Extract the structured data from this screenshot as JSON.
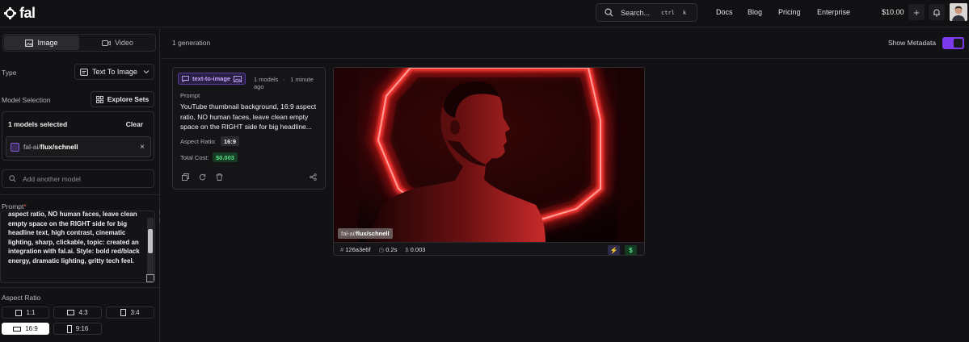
{
  "header": {
    "logo_text": "fal",
    "search_label": "Search...",
    "shortcut_ctrl": "ctrl",
    "shortcut_key": "k",
    "nav": [
      "Docs",
      "Blog",
      "Pricing",
      "Enterprise"
    ],
    "balance": "$10.00"
  },
  "sidebar": {
    "tabs": [
      "Image",
      "Video"
    ],
    "type_label": "Type",
    "type_value": "Text To Image",
    "model_selection_label": "Model Selection",
    "explore_sets_label": "Explore Sets",
    "models_selected": "1 models selected",
    "clear_label": "Clear",
    "model_prefix": "fal-ai/",
    "model_name": "flux/schnell",
    "add_model_placeholder": "Add another model",
    "prompt_label": "Prompt",
    "prompt_required": "*",
    "prompt_visible_text": "aspect ratio, NO human faces, leave clean empty space on the RIGHT side for big headline text, high contrast, cinematic lighting, sharp, clickable, topic: created an integration with fal.ai. Style: bold red/black energy, dramatic lighting, gritty tech feel.",
    "aspect_ratio_label": "Aspect Ratio",
    "aspect_ratios": [
      "1:1",
      "4:3",
      "3:4",
      "16:9",
      "9:16"
    ],
    "aspect_ratio_selected": "16:9"
  },
  "main": {
    "generation_count": "1 generation",
    "show_metadata_label": "Show Metadata",
    "show_metadata_on": true,
    "card": {
      "badge": "text-to-image",
      "models": "1 models",
      "separator": "·",
      "time_ago": "1 minute ago",
      "prompt_label": "Prompt",
      "prompt_text": "YouTube thumbnail background, 16:9 aspect ratio, NO human faces, leave clean empty space on the RIGHT side for big headline...",
      "aspect_ratio_label": "Aspect Ratio:",
      "aspect_ratio_value": "16:9",
      "total_cost_label": "Total Cost:",
      "total_cost_value": "$0.003"
    },
    "result": {
      "model_prefix": "fal-ai/",
      "model_name": "flux/schnell",
      "hash_symbol": "#",
      "id": "126a3e6f",
      "duration": "0.2s",
      "cost_symbol": "$",
      "cost": "0.003"
    }
  },
  "colors": {
    "accent": "#7c3aed",
    "cost_green": "#5fe08a",
    "neon_red": "#ff2a2a",
    "background": "#121214"
  }
}
